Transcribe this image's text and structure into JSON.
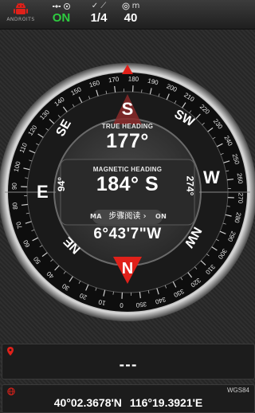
{
  "app": {
    "logo_text": "ANDROITS"
  },
  "status": {
    "satellites_value": "ON",
    "fix_value": "1/4",
    "altitude_unit": "m",
    "altitude_value": "40"
  },
  "compass": {
    "dial_labels": {
      "N": "N",
      "S": "S",
      "E": "E",
      "W": "W",
      "NE": "NE",
      "NW": "NW",
      "SE": "SE",
      "SW": "SW"
    },
    "side_left": "94°",
    "side_right": "274°",
    "true_heading_label": "TRUE HEADING",
    "true_heading_value": "177°",
    "magnetic_heading_label": "MAGNETIC HEADING",
    "magnetic_heading_value": "184° S",
    "declination_label_left": "MA",
    "declination_label_right": "ON",
    "declination_value": "6°43'7\"W",
    "overlay_text": "步骤阅读",
    "colors": {
      "accent": "#e0211a",
      "ring_dark": "#0e0e0e",
      "face": "#3a3a3a"
    }
  },
  "location": {
    "address": "---"
  },
  "coordinates": {
    "datum": "WGS84",
    "lat": "40°02.3678'N",
    "lon": "116°19.3921'E"
  }
}
